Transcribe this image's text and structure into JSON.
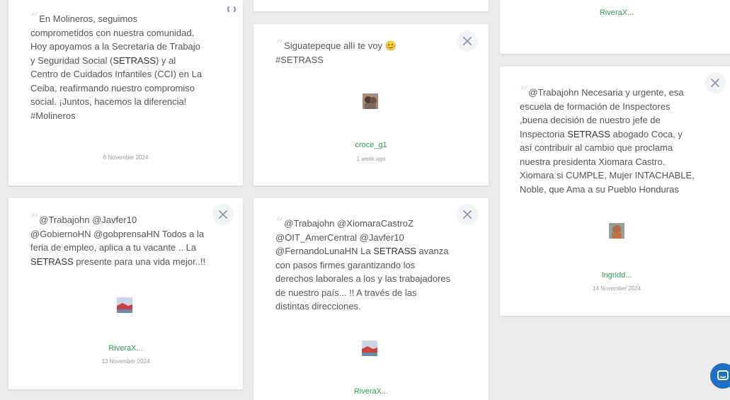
{
  "colors": {
    "background": "#ebebeb",
    "card": "#ffffff",
    "author": "#2e9e4a",
    "text": "#555555",
    "x_icon": "#8a96b4",
    "chat_button": "#1c6fc6"
  },
  "cards": [
    {
      "text": "En Molineros, seguimos\ncomprometidos con nuestra comunidad.\nHoy apoyamos a la Secretaría de Trabajo\ny Seguridad Social (",
      "highlight": "SETRASS",
      "text_after": ") y al\nCentro de Cuidados Infantiles (CCI) en La\nCeiba, reafirmando nuestro compromiso\nsocial. ¡Juntos, hacemos la diferencia!\n#Molineros",
      "date": "6 November 2024",
      "icon": "share-icon"
    },
    {
      "text": "Siguatepeque allí te voy ",
      "emoji": "😊",
      "text2": "\n#SETRASS",
      "author": "croce_g1",
      "date": "1 week ago",
      "icon": "x-icon"
    },
    {
      "author": "RiveraX..."
    },
    {
      "text": "@Trabajohn Necesaria y urgente, esa\nescuela de formación de Inspectores\n,buena decisión de nuestro jefe de\nInspectoria ",
      "highlight": "SETRASS",
      "text_after": " abogado Coca, y\nasí contribuir al cambio que proclama\nnuestra presidenta Xiomara Castro.\nXiomara si CUMPLE, Mujer INTACHABLE,\nNoble, que Ama a su Pueblo Honduras",
      "author": "Ingridd...",
      "date": "14 November 2024",
      "icon": "x-icon"
    },
    {
      "text": "@Trabajohn @Javfer10\n@GobiernoHN @gobprensaHN Todos a la\nferia de empleo, aplica a tu vacante .. La\n",
      "highlight": "SETRASS",
      "text_after": " presente para una vida mejor..!!",
      "author": "RiveraX...",
      "date": "13 November 2024",
      "icon": "x-icon"
    },
    {
      "text": "@Trabajohn @XiomaraCastroZ\n@OIT_AmerCentral @Javfer10\n@FernandoLunaHN La ",
      "highlight": "SETRASS",
      "text_after": " avanza\ncon pasos firmes garantizando los\nderechos laborales a los y las trabajadores\nde nuestro país... !! A través de las\ndistintas direcciones.",
      "author": "RiveraX...",
      "icon": "x-icon"
    }
  ],
  "chat": {
    "icon": "chat-icon"
  }
}
